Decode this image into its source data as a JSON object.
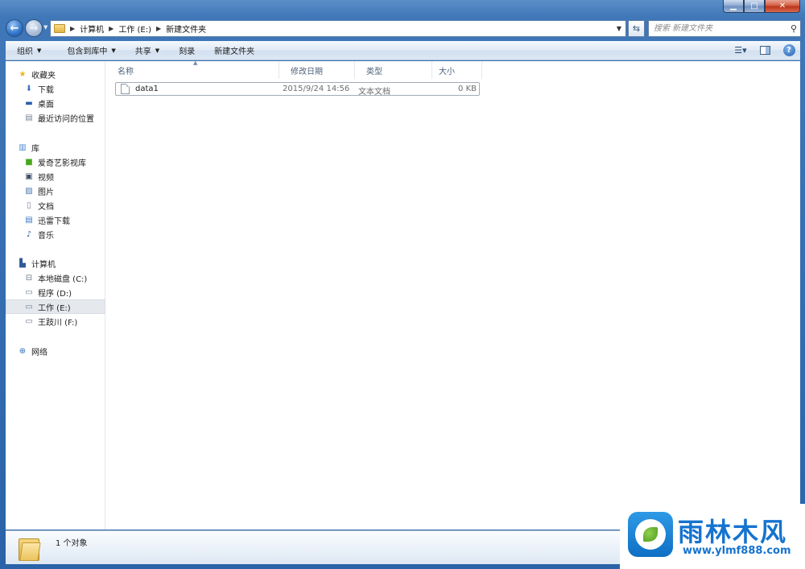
{
  "window": {
    "buttons": {
      "minimize": "▁",
      "maximize": "□",
      "close": "✕"
    }
  },
  "address": {
    "crumbs": [
      "计算机",
      "工作 (E:)",
      "新建文件夹"
    ]
  },
  "search": {
    "placeholder": "搜索 新建文件夹"
  },
  "toolbar": {
    "organize": "组织",
    "include_in_library": "包含到库中",
    "share": "共享",
    "burn": "刻录",
    "new_folder": "新建文件夹"
  },
  "sidebar": {
    "favorites": {
      "label": "收藏夹",
      "items": [
        "下载",
        "桌面",
        "最近访问的位置"
      ]
    },
    "libraries": {
      "label": "库",
      "items": [
        "爱奇艺影视库",
        "视频",
        "图片",
        "文档",
        "迅雷下载",
        "音乐"
      ]
    },
    "computer": {
      "label": "计算机",
      "items": [
        "本地磁盘 (C:)",
        "程序 (D:)",
        "工作 (E:)",
        "王跂川 (F:)"
      ],
      "selected": "工作 (E:)"
    },
    "network": {
      "label": "网络"
    }
  },
  "columns": [
    "名称",
    "修改日期",
    "类型",
    "大小"
  ],
  "files": [
    {
      "name": "data1",
      "modified": "2015/9/24 14:56",
      "type": "文本文档",
      "size": "0 KB"
    }
  ],
  "status": {
    "count_text": "1 个对象"
  },
  "logo": {
    "title": "雨林木风",
    "url": "www.ylmf888.com"
  },
  "colors": {
    "frame": "#2a63a8",
    "logo_blue": "#1673cf",
    "selection": "#e5e9ee"
  }
}
